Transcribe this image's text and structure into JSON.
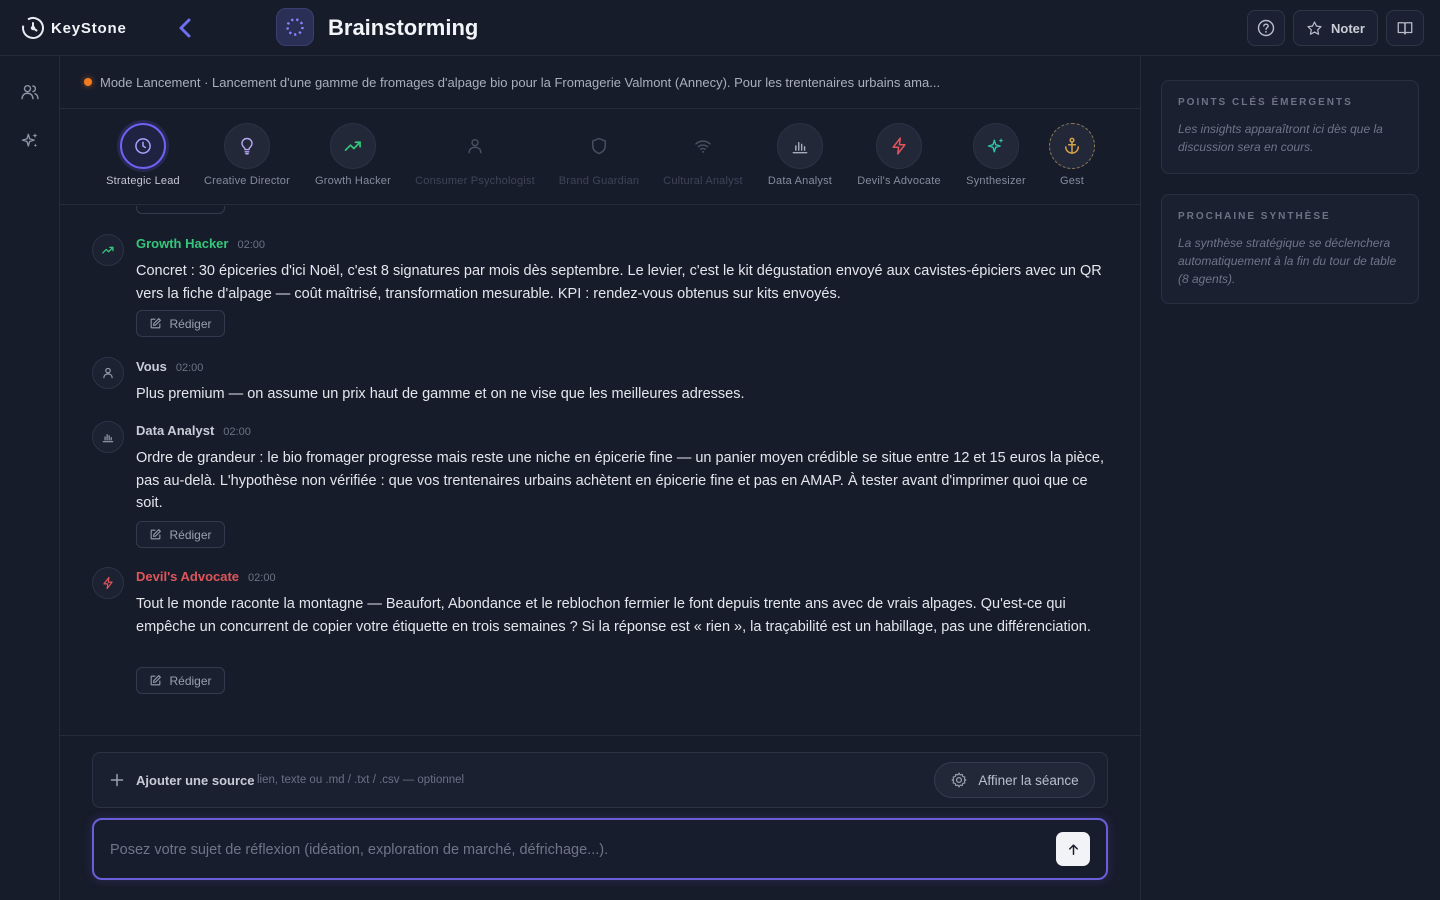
{
  "app": {
    "logo_text": "KeyStone",
    "title": "Brainstorming"
  },
  "header": {
    "help_icon": "question-circle-icon",
    "rate_label": "Noter",
    "panel_icon": "book-open-icon"
  },
  "rail": {
    "items": [
      "users-icon",
      "sparkles-icon"
    ]
  },
  "context": {
    "status_color": "#f47b20",
    "text": "Mode Lancement · Lancement d'une gamme de fromages d'alpage bio pour la Fromagerie Valmont (Annecy). Pour les trentenaires urbains ama..."
  },
  "agents": [
    {
      "name": "Strategic Lead",
      "icon": "clock-icon",
      "state": "active"
    },
    {
      "name": "Creative Director",
      "icon": "lightbulb-icon",
      "state": "normal"
    },
    {
      "name": "Growth Hacker",
      "icon": "trending-up-icon",
      "state": "normal"
    },
    {
      "name": "Consumer Psychologist",
      "icon": "user-icon",
      "state": "dimmed"
    },
    {
      "name": "Brand Guardian",
      "icon": "shield-icon",
      "state": "dimmed"
    },
    {
      "name": "Cultural Analyst",
      "icon": "wifi-icon",
      "state": "dimmed"
    },
    {
      "name": "Data Analyst",
      "icon": "bar-chart-icon",
      "state": "normal"
    },
    {
      "name": "Devil's Advocate",
      "icon": "lightning-icon",
      "state": "normal"
    },
    {
      "name": "Synthesizer",
      "icon": "sparkles-icon",
      "state": "normal"
    },
    {
      "name": "Gest",
      "icon": "anchor-icon",
      "state": "normal"
    }
  ],
  "messages": [
    {
      "author": "Growth Hacker",
      "time": "02:00",
      "color": "#34c77b",
      "icon": "trending-up-icon",
      "text": "Concret : 30 épiceries d'ici Noël, c'est 8 signatures par mois dès septembre. Le levier, c'est le kit dégustation envoyé aux cavistes-épiciers avec un QR vers la fiche d'alpage — coût maîtrisé, transformation mesurable. KPI : rendez-vous obtenus sur kits envoyés.",
      "action": "Rédiger"
    },
    {
      "author": "Vous",
      "time": "02:00",
      "color": "#c9cdd8",
      "icon": "user-icon",
      "text": "Plus premium — on assume un prix haut de gamme et on ne vise que les meilleures adresses."
    },
    {
      "author": "Data Analyst",
      "time": "02:00",
      "color": "#c9cdd8",
      "icon": "bar-chart-icon",
      "text": "Ordre de grandeur : le bio fromager progresse mais reste une niche en épicerie fine — un panier moyen crédible se situe entre 12 et 15 euros la pièce, pas au-delà. L'hypothèse non vérifiée : que vos trentenaires urbains achètent en épicerie fine et pas en AMAP. À tester avant d'imprimer quoi que ce soit.",
      "action": "Rédiger"
    },
    {
      "author": "Devil's Advocate",
      "time": "02:00",
      "color": "#e0555a",
      "icon": "lightning-icon",
      "text": "Tout le monde raconte la montagne — Beaufort, Abondance et le reblochon fermier le font depuis trente ans avec de vrais alpages. Qu'est-ce qui empêche un concurrent de copier votre étiquette en trois semaines ? Si la réponse est « rien », la traçabilité est un habillage, pas une différenciation.",
      "action": "Rédiger"
    }
  ],
  "composer": {
    "source_label": "Ajouter une source",
    "source_hint": "lien, texte ou .md / .txt / .csv — optionnel",
    "refine_label": "Affiner la séance",
    "placeholder": "Posez votre sujet de réflexion (idéation, exploration de marché, défrichage...).",
    "value": ""
  },
  "sidebar": {
    "insights_title": "POINTS CLÉS ÉMERGENTS",
    "insights_body": "Les insights apparaîtront ici dès que la discussion sera en cours.",
    "synthesis_title": "PROCHAINE SYNTHÈSE",
    "synthesis_body": "La synthèse stratégique se déclenchera automatiquement à la fin du tour de table (8 agents)."
  },
  "colors": {
    "accent": "#6d63f5",
    "background": "#171c2b",
    "growth": "#34c77b",
    "devil": "#e0555a",
    "synth": "#2ec4a6",
    "gest": "#d4a24a"
  }
}
